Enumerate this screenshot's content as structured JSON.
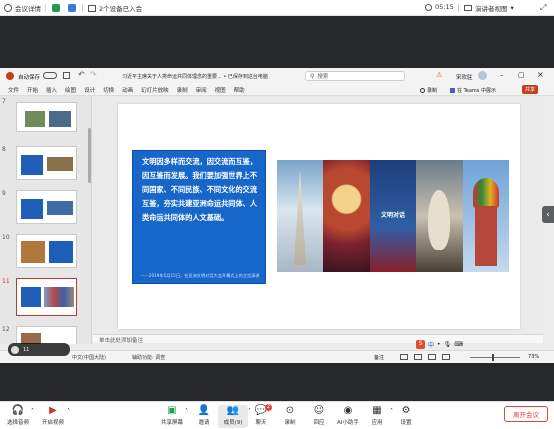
{
  "topbar": {
    "meeting_details": "会议详情",
    "devices_in_meeting": "2个设备已入会",
    "time": "05:15",
    "presenter_view": "演讲者视图"
  },
  "ppt": {
    "autosave": "自动保存",
    "doc_title": "习近平主席关于人类命运共同体理念的重要... • 已保存到这台电脑",
    "search_placeholder": "搜索",
    "user": "宋欢驻",
    "menu": [
      "文件",
      "开始",
      "插入",
      "绘图",
      "设计",
      "切换",
      "动画",
      "幻灯片放映",
      "录制",
      "审阅",
      "视图",
      "帮助"
    ],
    "record_btn": "录制",
    "teams_btn": "在 Teams 中展示",
    "share_btn": "共享",
    "thumbnails": [
      {
        "num": "7"
      },
      {
        "num": "8"
      },
      {
        "num": "9"
      },
      {
        "num": "10"
      },
      {
        "num": "11"
      },
      {
        "num": "12"
      }
    ],
    "slide": {
      "quote": "文明因多样而交流，因交流而互鉴，因互鉴而发展。我们要加强世界上不同国家、不同民族、不同文化的交流互鉴，夯实共建亚洲命运共同体、人类命运共同体的人文基础。",
      "quote_source": "——2019年5月15日，在亚洲文明对话大会开幕式上的主旨演讲",
      "panel_text": "文明对话"
    },
    "notes_placeholder": "单击此处添加备注",
    "status_lang": "中文(中国大陆)",
    "status_accessibility": "辅助功能: 调查",
    "status_notes": "备注",
    "zoom": "73%"
  },
  "float": {
    "slide_counter": "11"
  },
  "toolbar": {
    "mic": "选择音频",
    "video": "开启视频",
    "share": "共享屏幕",
    "invite": "邀请",
    "members": "成员(9)",
    "chat": "聊天",
    "chat_badge": "2",
    "record": "录制",
    "react": "回应",
    "ai": "AI小助手",
    "apps": "应用",
    "settings": "设置",
    "leave": "离开会议"
  }
}
